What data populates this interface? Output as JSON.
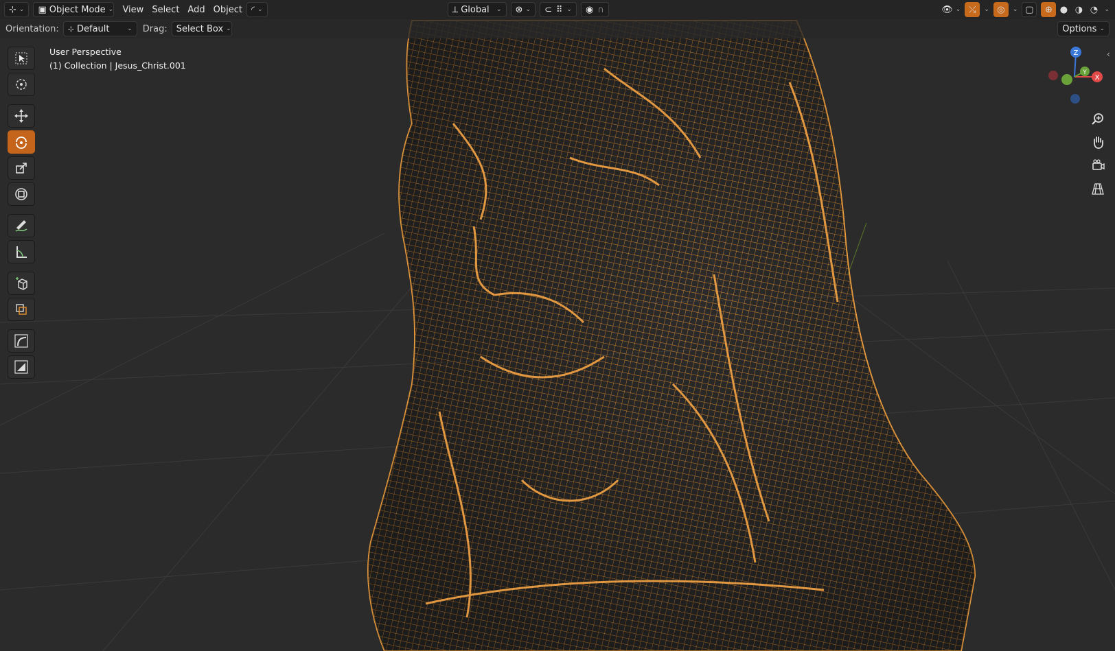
{
  "header": {
    "mode_label": "Object Mode",
    "menus": [
      "View",
      "Select",
      "Add",
      "Object"
    ],
    "transform_orientation": "Global",
    "icons": [
      "editor-type-icon",
      "mode-icon",
      "curve-icon",
      "orientation-icon",
      "pivot-icon",
      "snap-icon",
      "snap-grid-icon",
      "proportional-icon",
      "falloff-icon",
      "visibility-icon",
      "gizmo-icon",
      "overlay-icon",
      "xray-icon",
      "wireframe-shading-icon",
      "solid-shading-icon",
      "material-shading-icon",
      "rendered-shading-icon"
    ]
  },
  "tool_header": {
    "orientation_label": "Orientation:",
    "orientation_value": "Default",
    "drag_label": "Drag:",
    "drag_value": "Select Box",
    "options_label": "Options"
  },
  "viewport": {
    "view_name": "User Perspective",
    "collection_line": "(1) Collection | Jesus_Christ.001",
    "wire_color": "#e8912f",
    "background_color": "#2b2b2b"
  },
  "toolbar": {
    "tools": [
      "select-box",
      "cursor",
      "move",
      "rotate",
      "scale",
      "transform",
      "annotate",
      "measure",
      "add-cube",
      "add-cone",
      "curve-tool",
      "shrink-tool"
    ],
    "active_tool": "rotate",
    "accent_color": "#c4651b"
  },
  "gizmo": {
    "x_label": "X",
    "y_label": "Y",
    "z_label": "Z",
    "x_color": "#e24a4a",
    "y_color": "#6aa23a",
    "z_color": "#3b78d8"
  }
}
